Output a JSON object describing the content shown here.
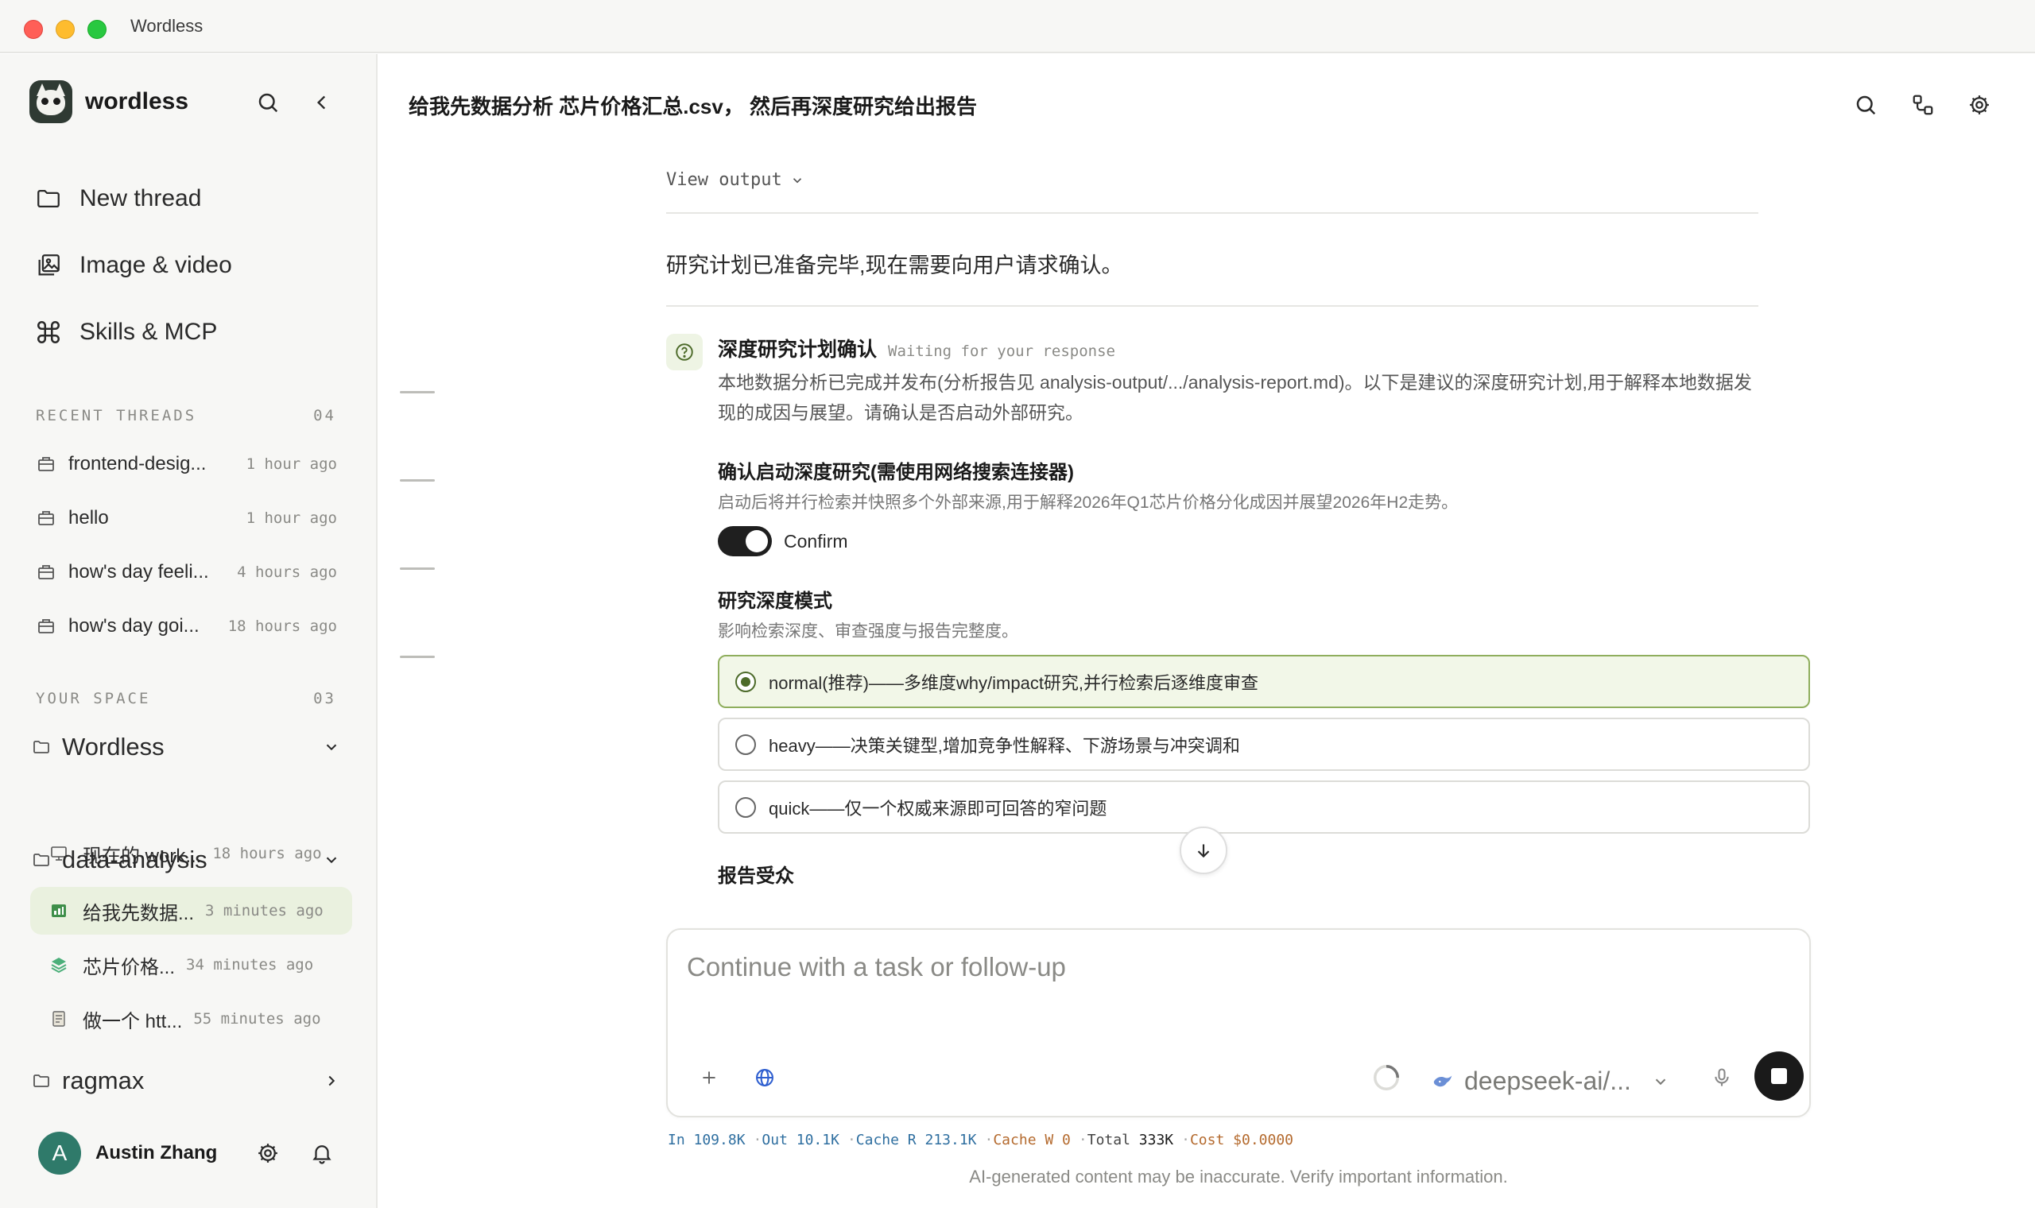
{
  "window": {
    "title": "Wordless"
  },
  "sidebar": {
    "brand": "wordless",
    "nav": [
      {
        "label": "New thread",
        "icon": "folder-icon"
      },
      {
        "label": "Image & video",
        "icon": "image-icon"
      },
      {
        "label": "Skills & MCP",
        "icon": "command-icon"
      }
    ],
    "recent": {
      "title": "RECENT THREADS",
      "count": "04",
      "items": [
        {
          "label": "frontend-desig...",
          "time": "1 hour ago"
        },
        {
          "label": "hello",
          "time": "1 hour ago"
        },
        {
          "label": "how's day feeli...",
          "time": "4 hours ago"
        },
        {
          "label": "how's day goi...",
          "time": "18 hours ago"
        }
      ]
    },
    "space": {
      "title": "YOUR SPACE",
      "count": "03",
      "folders": [
        {
          "label": "Wordless",
          "threads": [
            {
              "label": "现在的 work...",
              "time": "18 hours ago"
            }
          ]
        },
        {
          "label": "data-analysis",
          "threads": [
            {
              "label": "给我先数据...",
              "time": "3 minutes ago"
            },
            {
              "label": "芯片价格...",
              "time": "34 minutes ago"
            },
            {
              "label": "做一个 htt...",
              "time": "55 minutes ago"
            }
          ]
        },
        {
          "label": "ragmax",
          "threads": []
        }
      ]
    },
    "user": {
      "initial": "A",
      "name": "Austin Zhang"
    }
  },
  "main": {
    "title": "给我先数据分析 芯片价格汇总.csv， 然后再深度研究给出报告",
    "view_output": "View output",
    "status": "研究计划已准备完毕,现在需要向用户请求确认。",
    "question": {
      "title": "深度研究计划确认",
      "waiting": "Waiting for your response",
      "desc": "本地数据分析已完成并发布(分析报告见 analysis-output/.../analysis-report.md)。以下是建议的深度研究计划,用于解释本地数据发现的成因与展望。请确认是否启动外部研究。",
      "field1_title": "确认启动深度研究(需使用网络搜索连接器)",
      "field1_desc": "启动后将并行检索并快照多个外部来源,用于解释2026年Q1芯片价格分化成因并展望2026年H2走势。",
      "toggle_label": "Confirm",
      "field2_title": "研究深度模式",
      "field2_desc": "影响检索深度、审查强度与报告完整度。",
      "options": [
        "normal(推荐)——多维度why/impact研究,并行检索后逐维度审查",
        "heavy——决策关键型,增加竞争性解释、下游场景与冲突调和",
        "quick——仅一个权威来源即可回答的窄问题"
      ],
      "field3_title": "报告受众"
    },
    "composer": {
      "placeholder": "Continue with a task or follow-up",
      "model": "deepseek-ai/..."
    },
    "stats": {
      "in": "In 109.8K",
      "out": "Out 10.1K",
      "cache_r": "Cache R 213.1K",
      "cache_w": "Cache W 0",
      "total_label": "Total",
      "total_value": "333K",
      "cost": "Cost $0.0000"
    },
    "disclaimer": "AI-generated content may be inaccurate. Verify important information."
  }
}
